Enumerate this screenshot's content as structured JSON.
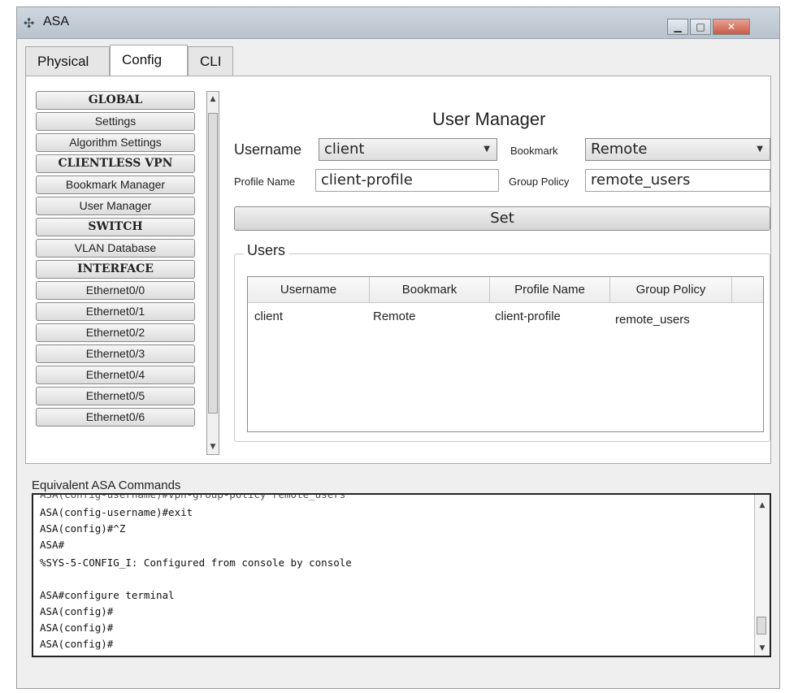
{
  "window": {
    "title": "ASA"
  },
  "tabs": [
    {
      "label": "Physical"
    },
    {
      "label": "Config"
    },
    {
      "label": "CLI"
    }
  ],
  "sidebar": {
    "items": [
      {
        "label": "GLOBAL",
        "type": "header"
      },
      {
        "label": "Settings",
        "type": "item"
      },
      {
        "label": "Algorithm Settings",
        "type": "item"
      },
      {
        "label": "CLIENTLESS VPN",
        "type": "header"
      },
      {
        "label": "Bookmark Manager",
        "type": "item"
      },
      {
        "label": "User Manager",
        "type": "item"
      },
      {
        "label": "SWITCH",
        "type": "header"
      },
      {
        "label": "VLAN Database",
        "type": "item"
      },
      {
        "label": "INTERFACE",
        "type": "header"
      },
      {
        "label": "Ethernet0/0",
        "type": "item"
      },
      {
        "label": "Ethernet0/1",
        "type": "item"
      },
      {
        "label": "Ethernet0/2",
        "type": "item"
      },
      {
        "label": "Ethernet0/3",
        "type": "item"
      },
      {
        "label": "Ethernet0/4",
        "type": "item"
      },
      {
        "label": "Ethernet0/5",
        "type": "item"
      },
      {
        "label": "Ethernet0/6",
        "type": "item"
      }
    ]
  },
  "user_manager": {
    "title": "User Manager",
    "username_label": "Username",
    "username_value": "client",
    "bookmark_label": "Bookmark",
    "bookmark_value": "Remote",
    "profile_label": "Profile Name",
    "profile_value": "client-profile",
    "group_label": "Group Policy",
    "group_value": "remote_users",
    "set_label": "Set"
  },
  "users": {
    "legend": "Users",
    "columns": [
      "Username",
      "Bookmark",
      "Profile Name",
      "Group Policy"
    ],
    "rows": [
      [
        "client",
        "Remote",
        "client-profile",
        "remote_users"
      ]
    ]
  },
  "console": {
    "label": "Equivalent ASA Commands",
    "lines": [
      "ASA(config-username)#vpn-group-policy remote_users",
      "ASA(config-username)#exit",
      "ASA(config)#^Z",
      "ASA#",
      "%SYS-5-CONFIG_I: Configured from console by console",
      "",
      "ASA#configure terminal",
      "ASA(config)#",
      "ASA(config)#",
      "ASA(config)#"
    ]
  },
  "colors": {
    "titlebar": "#c4ced8",
    "close_button": "#c65a47",
    "panel_bg": "#ffffff"
  },
  "icons": {
    "app": "router-icon",
    "minimize": "minimize-icon",
    "maximize": "maximize-icon",
    "close": "close-icon"
  }
}
